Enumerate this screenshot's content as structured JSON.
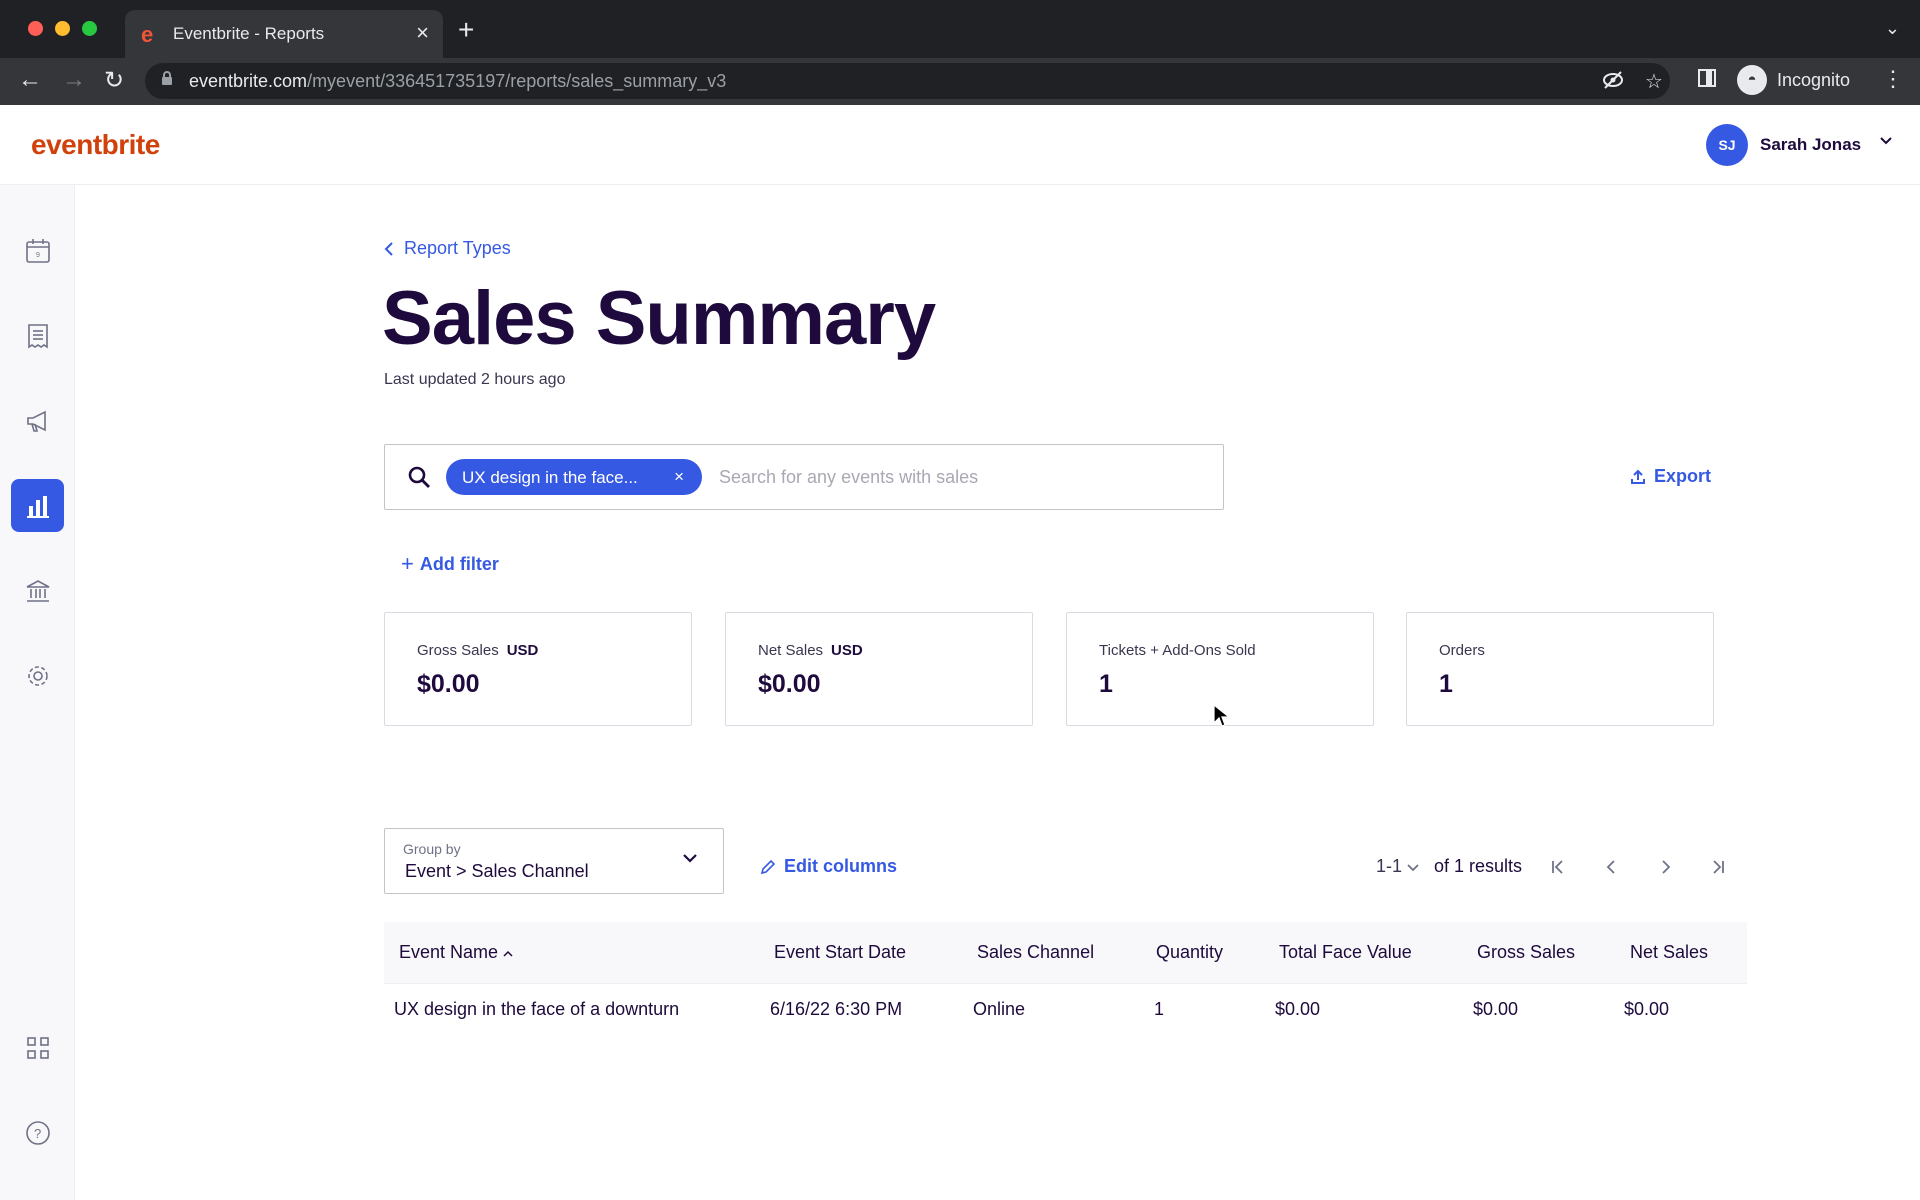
{
  "browser": {
    "tab_title": "Eventbrite - Reports",
    "url_host": "eventbrite.com",
    "url_path": "/myevent/336451735197/reports/sales_summary_v3",
    "profile_label": "Incognito"
  },
  "header": {
    "logo": "eventbrite",
    "user_initials": "SJ",
    "user_name": "Sarah Jonas"
  },
  "sidebar": {
    "items": [
      {
        "icon": "calendar-icon"
      },
      {
        "icon": "orders-icon"
      },
      {
        "icon": "megaphone-icon"
      },
      {
        "icon": "reports-icon",
        "active": true
      },
      {
        "icon": "bank-icon"
      },
      {
        "icon": "settings-icon"
      },
      {
        "icon": "apps-grid-icon"
      },
      {
        "icon": "help-icon"
      }
    ]
  },
  "main": {
    "back_link": "Report Types",
    "title": "Sales Summary",
    "updated": "Last updated 2 hours ago",
    "search": {
      "chip": "UX design in the face...",
      "placeholder": "Search for any events with sales"
    },
    "export": "Export",
    "add_filter": "Add filter",
    "cards": [
      {
        "label": "Gross Sales",
        "unit": "USD",
        "value": "$0.00"
      },
      {
        "label": "Net Sales",
        "unit": "USD",
        "value": "$0.00"
      },
      {
        "label": "Tickets + Add-Ons Sold",
        "unit": "",
        "value": "1"
      },
      {
        "label": "Orders",
        "unit": "",
        "value": "1"
      }
    ],
    "group_by": {
      "label": "Group by",
      "value": "Event > Sales Channel"
    },
    "edit_columns": "Edit columns",
    "pager": {
      "range": "1-1",
      "results": "of 1 results"
    },
    "table": {
      "headers": [
        "Event Name",
        "Event Start Date",
        "Sales Channel",
        "Quantity",
        "Total Face Value",
        "Gross Sales",
        "Net Sales"
      ],
      "rows": [
        [
          "UX design in the face of a downturn",
          "6/16/22 6:30 PM",
          "Online",
          "1",
          "$0.00",
          "$0.00",
          "$0.00"
        ]
      ]
    }
  },
  "colors": {
    "brand": "#d1410c",
    "accent": "#3659e3",
    "text": "#1e0a3c"
  }
}
